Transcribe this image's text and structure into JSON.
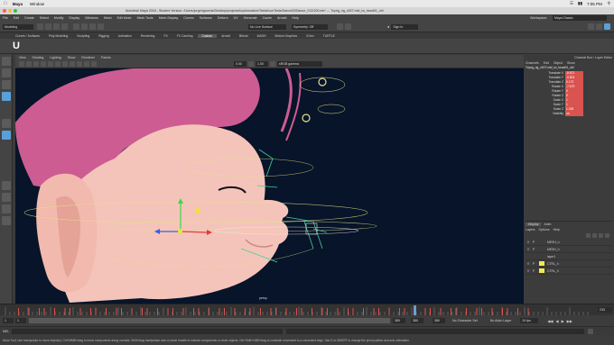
{
  "mac_menu": {
    "app": "Maya",
    "items": [
      "Window"
    ],
    "clock": "7:05 PM"
  },
  "window_title": "Autodesk Maya 2018 - Student Version: /Users/jorgeriganeris/Desktop/projects/toyAnimation/Tests/IconTests/Dance03/Dance_012/100.mb* --- Toyrig_rig_v007:mid_lw_head01_ctrl",
  "main_menu": [
    "File",
    "Edit",
    "Create",
    "Select",
    "Modify",
    "Display",
    "Windows",
    "Mesh",
    "Edit Mesh",
    "Mesh Tools",
    "Mesh Display",
    "Curves",
    "Surfaces",
    "Deform",
    "UV",
    "Generate",
    "Cache",
    "Arnold",
    "Help"
  ],
  "workspace": {
    "label": "Workspace:",
    "value": "Maya Classic"
  },
  "status_line": {
    "mode": "Modeling",
    "live_surface": "No Live Surface",
    "symmetry": "Symmetry: Off",
    "sign_in": "Sign In"
  },
  "shelf_tabs": [
    "Curves / Surfaces",
    "Poly Modeling",
    "Sculpting",
    "Rigging",
    "Animation",
    "Rendering",
    "FX",
    "FX Caching",
    "Custom",
    "Arnold",
    "Bifrost",
    "MASH",
    "Motion Graphics",
    "XGen",
    "TURTLE"
  ],
  "shelf_active": "Custom",
  "viewport": {
    "menu": [
      "View",
      "Shading",
      "Lighting",
      "Show",
      "Renderer",
      "Panels"
    ],
    "field_a": "0.00",
    "field_b": "1.00",
    "color_space": "sRGB gamma",
    "camera": "persp"
  },
  "channel_box": {
    "tabs": [
      "Channel Box / Layer Editor"
    ],
    "menu": [
      "Channels",
      "Edit",
      "Object",
      "Show"
    ],
    "node": "Toyrig_rig_v007:mid_lw_head01_ctrl",
    "attributes": [
      {
        "name": "Translate X",
        "value": "-8.671"
      },
      {
        "name": "Translate Y",
        "value": "-0.804"
      },
      {
        "name": "Translate Z",
        "value": "0.173"
      },
      {
        "name": "Rotate X",
        "value": "-7.679"
      },
      {
        "name": "Rotate Y",
        "value": "0"
      },
      {
        "name": "Rotate Z",
        "value": "0"
      },
      {
        "name": "Scale X",
        "value": "1"
      },
      {
        "name": "Scale Y",
        "value": "1"
      },
      {
        "name": "Scale Z",
        "value": "1.028"
      },
      {
        "name": "Visibility",
        "value": "on"
      }
    ]
  },
  "layers": {
    "tabs": [
      "Display",
      "Anim"
    ],
    "menu": [
      "Layers",
      "Options",
      "Help"
    ],
    "rows": [
      {
        "v": "V",
        "p": "P",
        "name": "MESH_h",
        "color": "#3c3c3c"
      },
      {
        "v": "V",
        "p": "P",
        "name": "MESH_h",
        "color": "#3c3c3c"
      },
      {
        "v": "",
        "p": "",
        "name": "layer1",
        "color": "#3c3c3c"
      },
      {
        "v": "V",
        "p": "P",
        "name": "CTRL_h",
        "color": "#f2e94e"
      },
      {
        "v": "V",
        "p": "P",
        "name": "CTRL_h",
        "color": "#f2e94e"
      }
    ]
  },
  "timeline": {
    "current_frame": "233",
    "start": "1",
    "inner_start": "1",
    "inner_end": "380",
    "end_field": "380",
    "end": "380",
    "character_set": "No Character Set",
    "anim_layer": "No Anim Layer",
    "fps": "24 fps"
  },
  "help_line": "Move Tool: Use manipulator to move object(s). Ctrl+MMB+drag to move components along normals. Shift+drag manipulator axis or plane handle to extrude components or clone objects. Ctrl+Shift+LMB+drag to constrain movement to a connected edge. Use D or INSERT to change the pivot position and axis orientation.",
  "colors": {
    "maya_blue": "#2fb8c8",
    "viewport_bg": "#071429",
    "skin": "#f4c4ba",
    "hair": "#cc5c92",
    "keyed_attr": "#d9534f"
  }
}
